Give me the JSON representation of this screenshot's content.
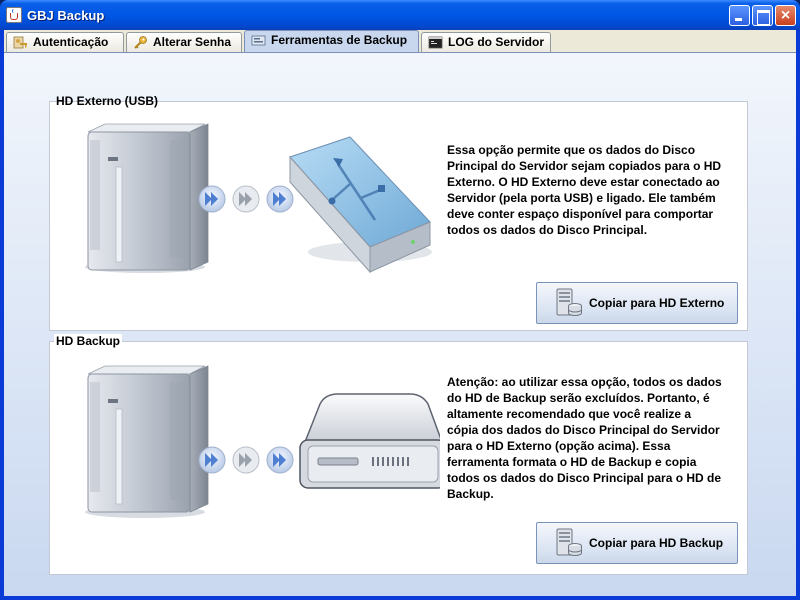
{
  "window": {
    "title": "GBJ Backup",
    "controls": {
      "minimize": "",
      "maximize": "",
      "close": "×"
    }
  },
  "tabs": [
    {
      "label": "Autenticação",
      "icon": "key-user-icon",
      "active": false
    },
    {
      "label": "Alterar Senha",
      "icon": "key-icon",
      "active": false
    },
    {
      "label": "Ferramentas de Backup",
      "icon": "tools-icon",
      "active": true
    },
    {
      "label": "LOG do Servidor",
      "icon": "terminal-icon",
      "active": false
    }
  ],
  "sections": {
    "external": {
      "title": "HD Externo (USB)",
      "description": "Essa opção permite que os dados do Disco Principal do Servidor sejam copiados para o HD Externo. O HD Externo deve estar conectado ao Servidor (pela porta USB) e ligado. Ele também deve conter espaço disponível para comportar todos os dados do Disco Principal.",
      "button_label": "Copiar para HD Externo",
      "illustration": [
        "server-icon",
        "arrow-forward-icon",
        "usb-drive-icon"
      ]
    },
    "backup": {
      "title": "HD Backup",
      "description": "Atenção: ao utilizar essa opção, todos os dados do HD de Backup serão excluídos. Portanto, é altamente recomendado que você realize a cópia dos dados do Disco Principal do Servidor para o HD Externo (opção acima). Essa ferramenta formata o HD de Backup e copia todos os dados do Disco Principal para o HD de Backup.",
      "button_label": "Copiar para HD Backup",
      "illustration": [
        "server-icon",
        "arrow-forward-icon",
        "hard-drive-icon"
      ]
    }
  },
  "colors": {
    "titlebar": "#0057e5",
    "window_bg": "#ece9d8",
    "active_tab": "#c8d7ee",
    "button_border": "#7a93b8"
  }
}
